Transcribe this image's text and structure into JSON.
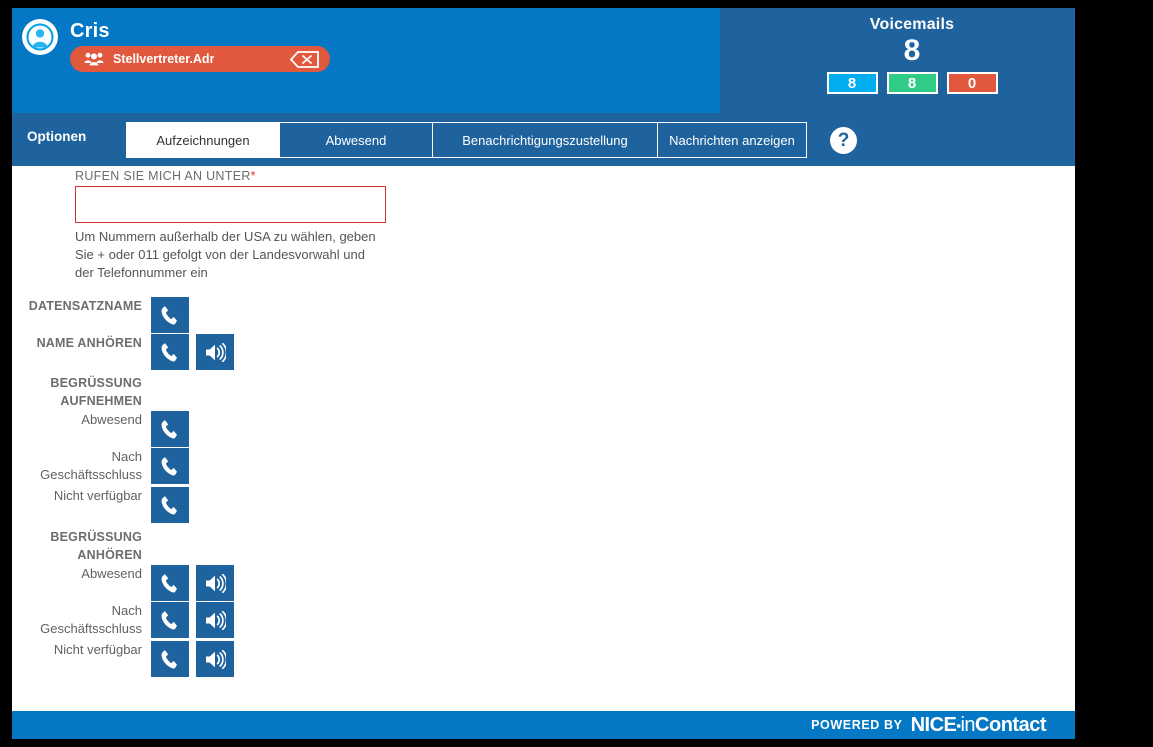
{
  "header": {
    "avatar_icon": "user-avatar-icon",
    "user_name": "Cris",
    "chip": {
      "icon": "group-people-icon",
      "label": "Stellvertreter.Adr",
      "close_icon": "close-x-icon"
    },
    "voicemails": {
      "title": "Voicemails",
      "count": "8",
      "badges": [
        {
          "value": "8",
          "color": "#00AEEF"
        },
        {
          "value": "8",
          "color": "#2ECC87"
        },
        {
          "value": "0",
          "color": "#E2583E"
        }
      ]
    }
  },
  "tabbar": {
    "section_label": "Optionen",
    "tabs": [
      {
        "label": "Aufzeichnungen",
        "active": true
      },
      {
        "label": "Abwesend",
        "active": false
      },
      {
        "label": "Benachrichtigungszustellung",
        "active": false
      },
      {
        "label": "Nachrichten anzeigen",
        "active": false
      }
    ],
    "help_icon": "question-mark-icon",
    "help_label": "?"
  },
  "form": {
    "phone_label": "RUFEN SIE MICH AN UNTER",
    "required_marker": "*",
    "phone_value": "",
    "phone_placeholder": "",
    "hint": "Um Nummern außerhalb der USA zu wählen, geben Sie + oder 011 gefolgt von der Landesvorwahl und der Telefonnummer ein",
    "rows": [
      {
        "label": "DATENSATZNAME",
        "caps": true,
        "buttons": [
          "phone-icon"
        ]
      },
      {
        "label": "NAME ANHÖREN",
        "caps": true,
        "buttons": [
          "phone-icon",
          "speaker-icon"
        ]
      },
      {
        "label": "BEGRÜSSUNG AUFNEHMEN",
        "caps": true,
        "buttons": []
      },
      {
        "label": "Abwesend",
        "caps": false,
        "buttons": [
          "phone-icon"
        ]
      },
      {
        "label": "Nach Geschäftsschluss",
        "caps": false,
        "buttons": [
          "phone-icon"
        ]
      },
      {
        "label": "Nicht verfügbar",
        "caps": false,
        "buttons": [
          "phone-icon"
        ]
      },
      {
        "label": "BEGRÜSSUNG ANHÖREN",
        "caps": true,
        "buttons": []
      },
      {
        "label": "Abwesend",
        "caps": false,
        "buttons": [
          "phone-icon",
          "speaker-icon"
        ]
      },
      {
        "label": "Nach Geschäftsschluss",
        "caps": false,
        "buttons": [
          "phone-icon",
          "speaker-icon"
        ]
      },
      {
        "label": "Nicht verfügbar",
        "caps": false,
        "buttons": [
          "phone-icon",
          "speaker-icon"
        ]
      }
    ]
  },
  "footer": {
    "powered_by": "POWERED BY",
    "brand_nice": "NICE",
    "brand_dot": "▪",
    "brand_in": "in",
    "brand_contact": "Contact"
  },
  "colors": {
    "header_blue": "#0478c4",
    "panel_blue": "#1f639e",
    "chip_red": "#e2583e",
    "required_red": "#d0342c"
  }
}
